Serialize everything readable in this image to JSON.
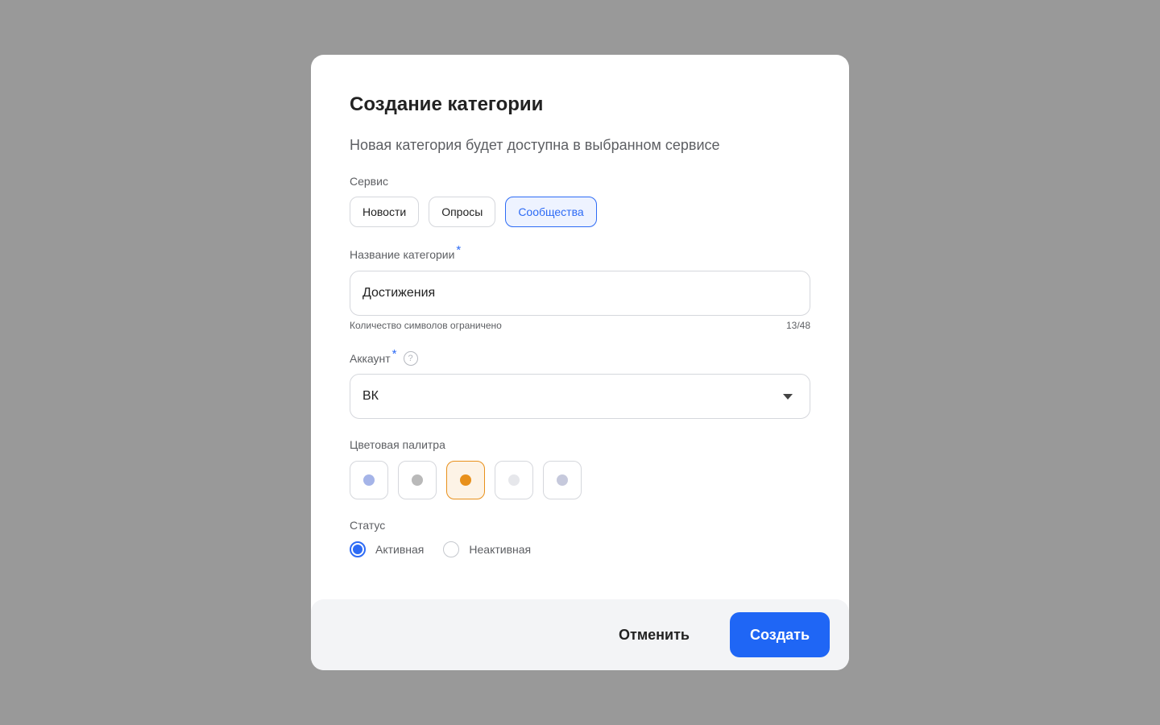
{
  "dialog": {
    "title": "Создание категории",
    "subtitle": "Новая категория будет доступна в выбранном сервисе"
  },
  "service": {
    "label": "Сервис",
    "options": [
      "Новости",
      "Опросы",
      "Сообщества"
    ],
    "selected": "Сообщества"
  },
  "category_name": {
    "label": "Название категории",
    "required_mark": "*",
    "value": "Достижения",
    "hint": "Количество символов ограничено",
    "counter": "13/48"
  },
  "account": {
    "label": "Аккаунт",
    "required_mark": "*",
    "help_icon": "question-circle-icon",
    "help_glyph": "?",
    "value": "ВК",
    "dropdown_icon": "caret-down-icon"
  },
  "palette": {
    "label": "Цветовая палитра",
    "colors": [
      "#a5b4e8",
      "#b9b9b9",
      "#e8901b",
      "#e6e7eb",
      "#c6c9dc"
    ],
    "selected_index": 2
  },
  "status": {
    "label": "Статус",
    "options": [
      "Активная",
      "Неактивная"
    ],
    "selected": "Активная"
  },
  "footer": {
    "cancel_label": "Отменить",
    "create_label": "Создать",
    "accent_color": "#1f66f5"
  }
}
